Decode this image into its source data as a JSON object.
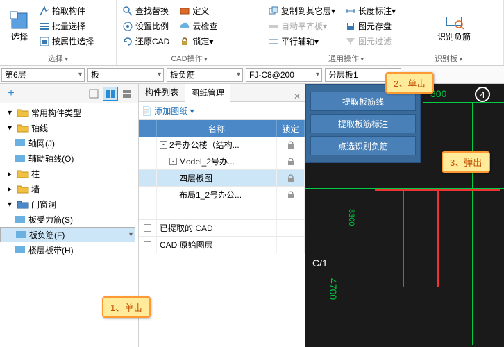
{
  "ribbon": {
    "select": {
      "label": "选择",
      "pick": "拾取构件",
      "batch": "批量选择",
      "byprop": "按属性选择"
    },
    "cad": {
      "label": "CAD操作",
      "find": "查找替换",
      "scale": "设置比例",
      "restore": "还原CAD",
      "define": "定义",
      "cloud": "云检查",
      "lock": "锁定"
    },
    "general": {
      "label": "通用操作",
      "copy": "复制到其它层",
      "autoflat": "自动平齐板",
      "parallel": "平行辅轴",
      "length": "长度标注",
      "save": "图元存盘",
      "filter": "图元过滤"
    },
    "recog": {
      "label": "识别板",
      "btn": "识别负筋"
    }
  },
  "filters": {
    "floor": "第6层",
    "cat": "板",
    "sub": "板负筋",
    "spec": "FJ-C8@200",
    "layer": "分层板1"
  },
  "tree": {
    "common": "常用构件类型",
    "axis": "轴线",
    "grid": "轴网(J)",
    "aux": "辅助轴线(O)",
    "col": "柱",
    "wall": "墙",
    "opening": "门窗洞",
    "force": "板受力筋(S)",
    "neg": "板负筋(F)",
    "strip": "楼层板带(H)"
  },
  "mid": {
    "tab1": "构件列表",
    "tab2": "图纸管理",
    "add": "添加图纸",
    "col_name": "名称",
    "col_lock": "锁定",
    "rows": [
      {
        "name": "2号办公楼（结构...",
        "lock": true,
        "pm": "-",
        "d": 0
      },
      {
        "name": "Model_2号办...",
        "lock": true,
        "pm": "-",
        "d": 1
      },
      {
        "name": "四层板图",
        "lock": true,
        "pm": "",
        "d": 2,
        "sel": true
      },
      {
        "name": "布局1_2号办公...",
        "lock": true,
        "pm": "",
        "d": 2
      },
      {
        "name": "",
        "lock": false,
        "pm": "",
        "d": 0
      },
      {
        "name": "已提取的 CAD",
        "lock": false,
        "pm": "",
        "d": 0,
        "cb": true
      },
      {
        "name": "CAD 原始图层",
        "lock": false,
        "pm": "",
        "d": 0,
        "cb": true
      }
    ]
  },
  "popup": {
    "b1": "提取板筋线",
    "b2": "提取板筋标注",
    "b3": "点选识别负筋"
  },
  "callouts": {
    "c1": "1、单击",
    "c2": "2、单击",
    "c3": "3、弹出"
  },
  "cad": {
    "d1": "3300",
    "d2": "4700",
    "d3": "300",
    "n4": "4",
    "cx": "C/1"
  }
}
